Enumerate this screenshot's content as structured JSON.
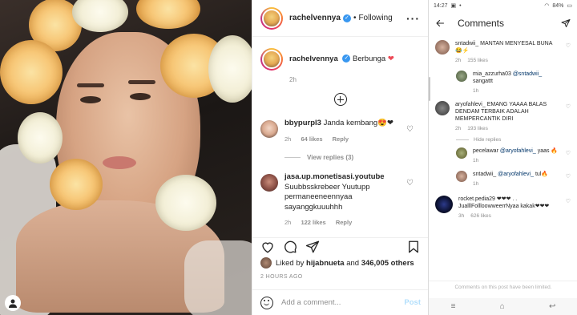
{
  "post": {
    "username": "rachelvennya",
    "following_label": "Following",
    "caption_text": "Berbunga",
    "caption_time": "2h",
    "comments": [
      {
        "user": "bbypurpl3",
        "text": "Janda kembang😍❤",
        "time": "2h",
        "likes": "64 likes",
        "reply": "Reply",
        "view_replies": "View replies (3)"
      },
      {
        "user": "jasa.up.monetisasi.youtube",
        "text": "Suubbsskrebeer Yuutupp permaneeneennyaa sayanggkuuuhhh",
        "time": "2h",
        "likes": "122 likes",
        "reply": "Reply"
      }
    ],
    "liked_by_prefix": "Liked by",
    "liked_by_user": "hijabnueta",
    "liked_by_suffix": "and",
    "liked_by_count": "346,005 others",
    "post_time": "2 HOURS AGO",
    "add_comment_placeholder": "Add a comment...",
    "post_button": "Post"
  },
  "mobile": {
    "status_time": "14:27",
    "battery": "84%",
    "title": "Comments",
    "comments": [
      {
        "user": "sntadwii_",
        "text": "MANTAN MENYESAL BUNA 😂⚡",
        "time": "2h",
        "likes": "155 likes"
      },
      {
        "user": "mia_azzurha03",
        "mention": "@sntadwii_",
        "text": "sangattt",
        "time": "1h"
      },
      {
        "user": "aryofahlevi_",
        "text": "EMANG YAAAA BALAS DENDAM TERBAIK ADALAH MEMPERCANTIK DIRI",
        "time": "2h",
        "likes": "193 likes"
      },
      {
        "user": "pecelawar",
        "mention": "@aryofahlevi_",
        "text": "yaas 🔥",
        "time": "1h"
      },
      {
        "user": "sntadwii_",
        "mention": "@aryofahlevi_",
        "text": "tul🔥",
        "time": "1h"
      },
      {
        "user": "rocket.pedia29",
        "text": "❤❤❤ . . JualllFollloowweerrNyaa kakak❤❤❤",
        "time": "3h",
        "likes": "626 likes"
      }
    ],
    "hide_replies": "Hide replies",
    "limited_notice": "Comments on this post have been limited."
  }
}
